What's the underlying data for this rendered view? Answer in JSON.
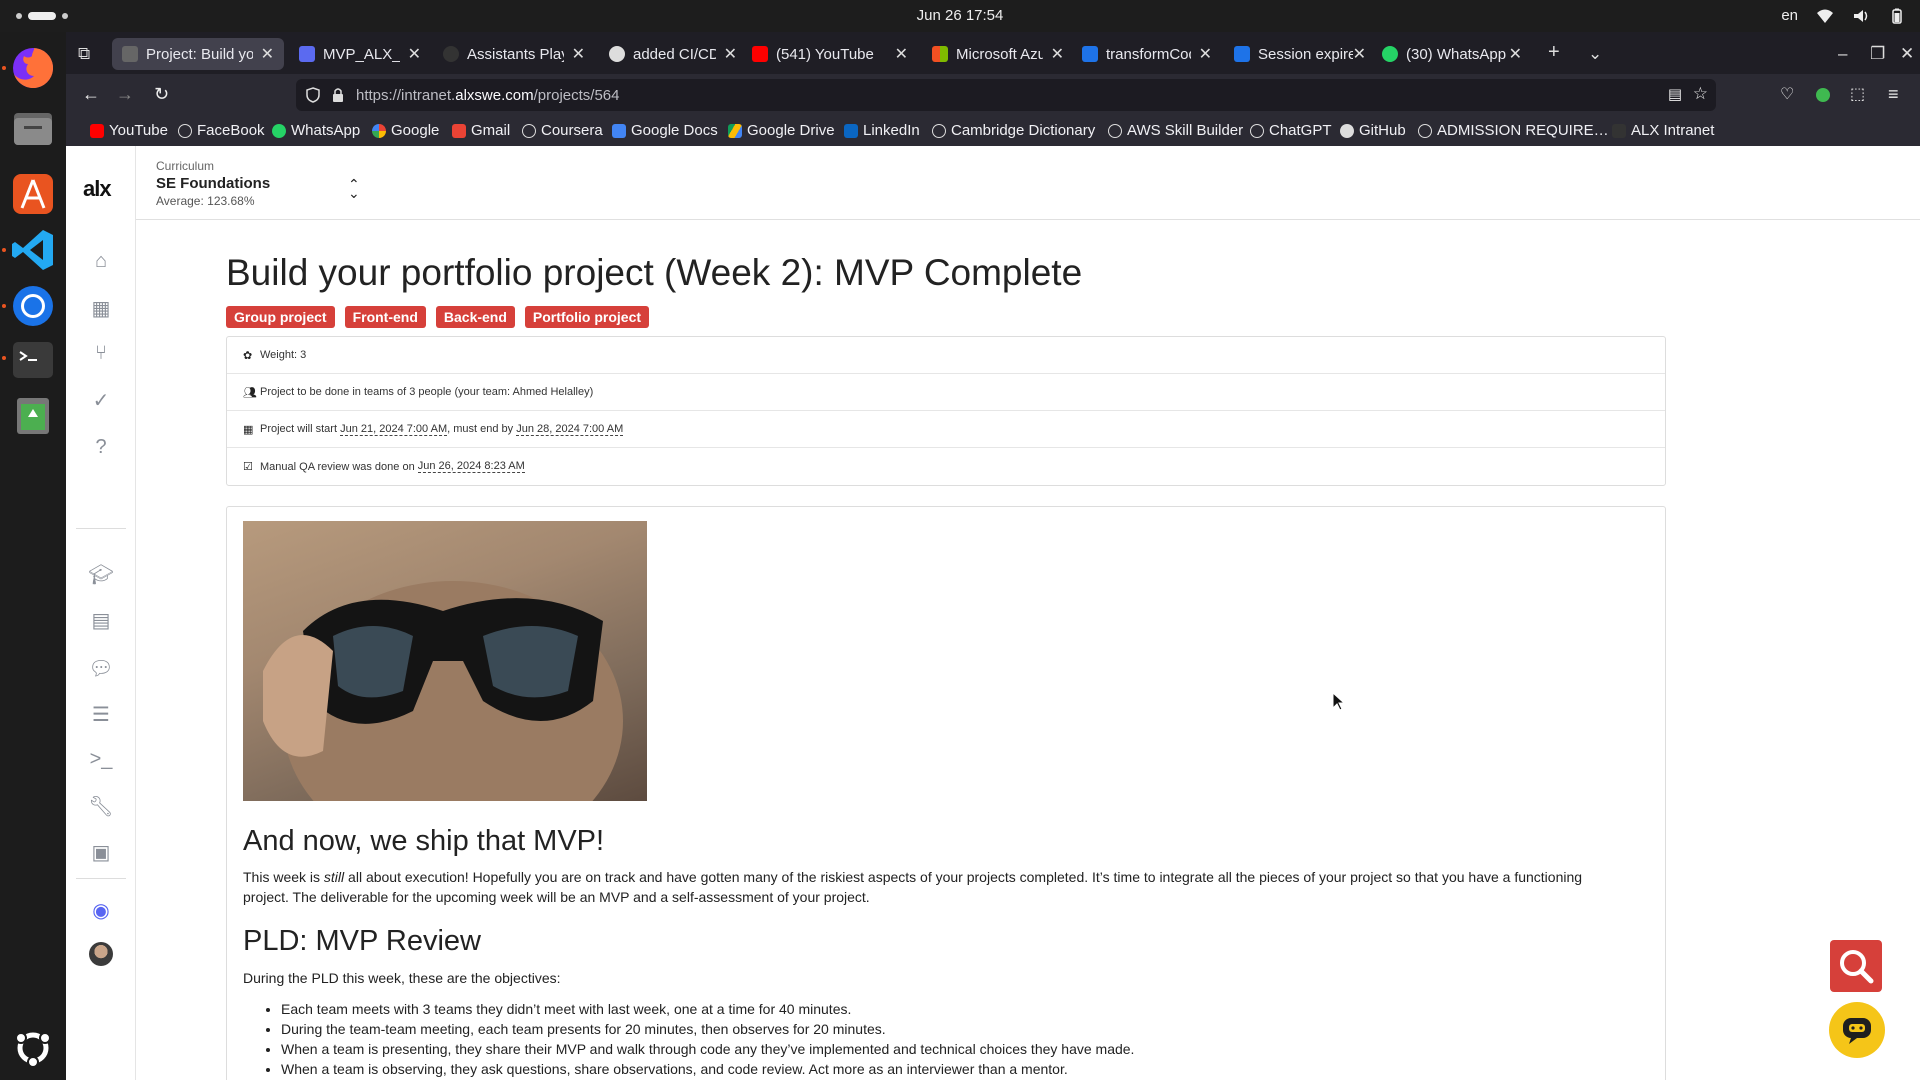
{
  "system": {
    "datetime": "Jun 26  17:54",
    "language": "en"
  },
  "browser": {
    "tabs": [
      {
        "title": "Project: Build your",
        "icon_color": "#444"
      },
      {
        "title": "MVP_ALX_WEEK_",
        "icon_color": "#5b6af0"
      },
      {
        "title": "Assistants Playgro",
        "icon_color": "#222"
      },
      {
        "title": "added CI/CD pipel",
        "icon_color": "#eee"
      },
      {
        "title": "(541) YouTube",
        "icon_color": "#f00"
      },
      {
        "title": "Microsoft Azure P",
        "icon_color": "#f25022"
      },
      {
        "title": "transformCoding",
        "icon_color": "#1e73e8"
      },
      {
        "title": "Session expired",
        "icon_color": "#1e73e8"
      },
      {
        "title": "(30) WhatsApp",
        "icon_color": "#25d366"
      }
    ],
    "url_prefix": "https://intranet.",
    "url_domain": "alxswe.com",
    "url_path": "/projects/564",
    "bookmarks": [
      {
        "label": "YouTube",
        "icon_color": "#f00"
      },
      {
        "label": "FaceBook",
        "icon_color": "#ccc"
      },
      {
        "label": "WhatsApp",
        "icon_color": "#25d366"
      },
      {
        "label": "Google",
        "icon_color": "#4285f4"
      },
      {
        "label": "Gmail",
        "icon_color": "#ea4335"
      },
      {
        "label": "Coursera",
        "icon_color": "#ccc"
      },
      {
        "label": "Google Docs",
        "icon_color": "#4285f4"
      },
      {
        "label": "Google Drive",
        "icon_color": "#fbbc04"
      },
      {
        "label": "LinkedIn",
        "icon_color": "#0a66c2"
      },
      {
        "label": "Cambridge Dictionary",
        "icon_color": "#ccc"
      },
      {
        "label": "AWS Skill Builder",
        "icon_color": "#ccc"
      },
      {
        "label": "ChatGPT",
        "icon_color": "#ccc"
      },
      {
        "label": "GitHub",
        "icon_color": "#ccc"
      },
      {
        "label": "ADMISSION REQUIRE…",
        "icon_color": "#ccc"
      },
      {
        "label": "ALX Intranet",
        "icon_color": "#333"
      }
    ]
  },
  "intranet": {
    "logo": "alx",
    "curriculum_label": "Curriculum",
    "curriculum_name": "SE Foundations",
    "curriculum_average": "Average: 123.68%"
  },
  "project": {
    "title": "Build your portfolio project (Week 2): MVP Complete",
    "badges": [
      "Group project",
      "Front-end",
      "Back-end",
      "Portfolio project"
    ],
    "weight": "Weight: 3",
    "team": "Project to be done in teams of 3 people (your team: Ahmed Helalley)",
    "schedule_prefix": "Project will start ",
    "start_date": "Jun 21, 2024 7:00 AM",
    "schedule_mid": ", must end by ",
    "end_date": "Jun 28, 2024 7:00 AM",
    "qa_prefix": "Manual QA review was done on ",
    "qa_date": "Jun 26, 2024 8:23 AM",
    "heading_ship": "And now, we ship that MVP!",
    "para_before_em": "This week is ",
    "para_em": "still",
    "para_after_em": " all about execution! Hopefully you are on track and have gotten many of the riskiest aspects of your projects completed. It’s time to integrate all the pieces of your project so that you have a functioning project. The deliverable for the upcoming week will be an MVP and a self-assessment of your project.",
    "heading_pld": "PLD: MVP Review",
    "pld_intro": "During the PLD this week, these are the objectives:",
    "objectives": [
      "Each team meets with 3 teams they didn’t meet with last week, one at a time for 40 minutes.",
      "During the team-team meeting, each team presents for 20 minutes, then observes for 20 minutes.",
      "When a team is presenting, they share their MVP and walk through code any they’ve implemented and technical choices they have made.",
      "When a team is observing, they ask questions, share observations, and code review. Act more as an interviewer than a mentor."
    ]
  }
}
